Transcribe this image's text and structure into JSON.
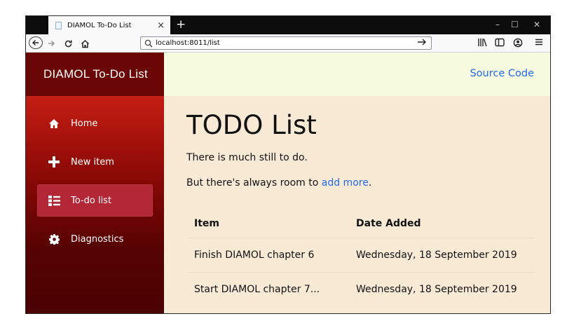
{
  "browser": {
    "tab_title": "DIAMOL To-Do List",
    "tab_close": "×",
    "new_tab": "+",
    "window_controls": [
      "–",
      "☐",
      "✕"
    ],
    "url": "localhost:8011/list",
    "icons": [
      "back-icon",
      "forward-icon",
      "reload-icon",
      "home-icon",
      "search-icon",
      "go-arrow-icon",
      "library-icon",
      "sidebar-icon",
      "account-icon",
      "menu-icon"
    ]
  },
  "app": {
    "brand": "DIAMOL To-Do List",
    "source_link": "Source Code",
    "accent": "#2469e8",
    "sidebar_active_color": "#b32636"
  },
  "nav": {
    "items": [
      {
        "label": "Home",
        "icon": "home-icon"
      },
      {
        "label": "New item",
        "icon": "plus-icon"
      },
      {
        "label": "To-do list",
        "icon": "list-icon",
        "active": true
      },
      {
        "label": "Diagnostics",
        "icon": "gear-icon"
      }
    ]
  },
  "main": {
    "title": "TODO List",
    "line1": "There is much still to do.",
    "line2_prefix": "But there's always room to ",
    "line2_link": "add more",
    "line2_suffix": ".",
    "table": {
      "headers": [
        "Item",
        "Date Added"
      ],
      "rows": [
        {
          "item": "Finish DIAMOL chapter 6",
          "date": "Wednesday, 18 September 2019"
        },
        {
          "item": "Start DIAMOL chapter 7...",
          "date": "Wednesday, 18 September 2019"
        }
      ]
    }
  }
}
